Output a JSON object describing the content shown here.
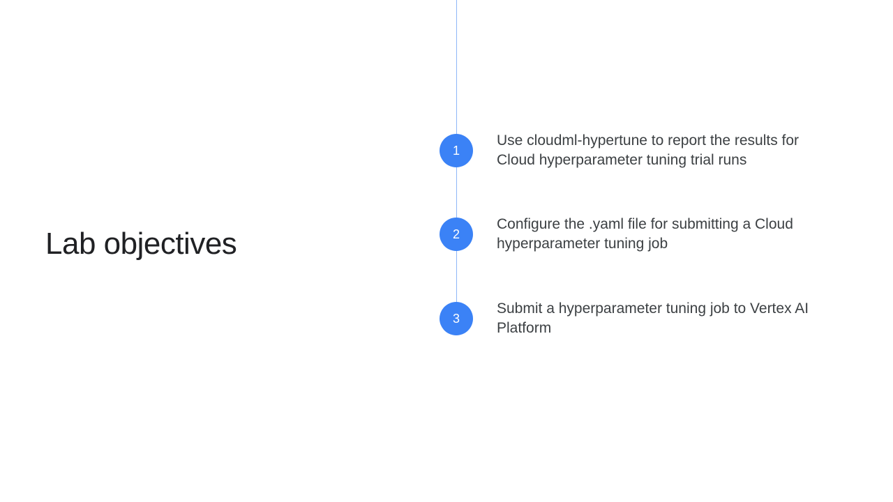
{
  "heading": "Lab objectives",
  "accent_color": "#3B82F6",
  "steps": [
    {
      "num": "1",
      "text": "Use cloudml-hypertune to report the results for Cloud hyperparameter tuning trial runs"
    },
    {
      "num": "2",
      "text": "Configure the .yaml file for submitting a Cloud hyperparameter tuning job"
    },
    {
      "num": "3",
      "text": "Submit a hyperparameter tuning job to Vertex AI Platform"
    }
  ]
}
